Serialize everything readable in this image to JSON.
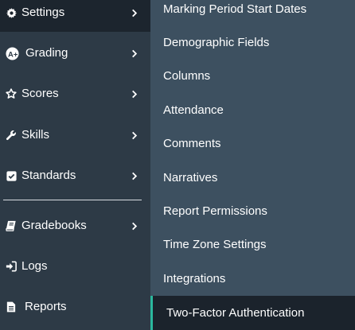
{
  "sidebar": {
    "items": [
      {
        "label": "Settings",
        "icon": "gear-icon",
        "active": true,
        "has_submenu": true
      },
      {
        "label": "Grading",
        "icon": "a-plus-icon",
        "active": false,
        "has_submenu": true
      },
      {
        "label": "Scores",
        "icon": "star-icon",
        "active": false,
        "has_submenu": true
      },
      {
        "label": "Skills",
        "icon": "wrench-icon",
        "active": false,
        "has_submenu": true
      },
      {
        "label": "Standards",
        "icon": "checkbox-icon",
        "active": false,
        "has_submenu": true
      },
      {
        "label": "Gradebooks",
        "icon": "book-icon",
        "active": false,
        "has_submenu": true
      },
      {
        "label": "Logs",
        "icon": "sign-in-icon",
        "active": false,
        "has_submenu": false
      },
      {
        "label": "Reports",
        "icon": "document-icon",
        "active": false,
        "has_submenu": false
      }
    ]
  },
  "submenu": {
    "items": [
      {
        "label": "Marking Period Start Dates"
      },
      {
        "label": "Demographic Fields"
      },
      {
        "label": "Columns"
      },
      {
        "label": "Attendance"
      },
      {
        "label": "Comments"
      },
      {
        "label": "Narratives"
      },
      {
        "label": "Report Permissions"
      },
      {
        "label": "Time Zone Settings"
      },
      {
        "label": "Integrations"
      },
      {
        "label": "Two-Factor Authentication"
      }
    ],
    "selected_index": 9
  },
  "colors": {
    "sidebar_bg": "#2d3a46",
    "sidebar_active_bg": "#1c252e",
    "submenu_bg": "#3d5060",
    "submenu_selected_bg": "#1b232c",
    "accent": "#2bb89e"
  }
}
